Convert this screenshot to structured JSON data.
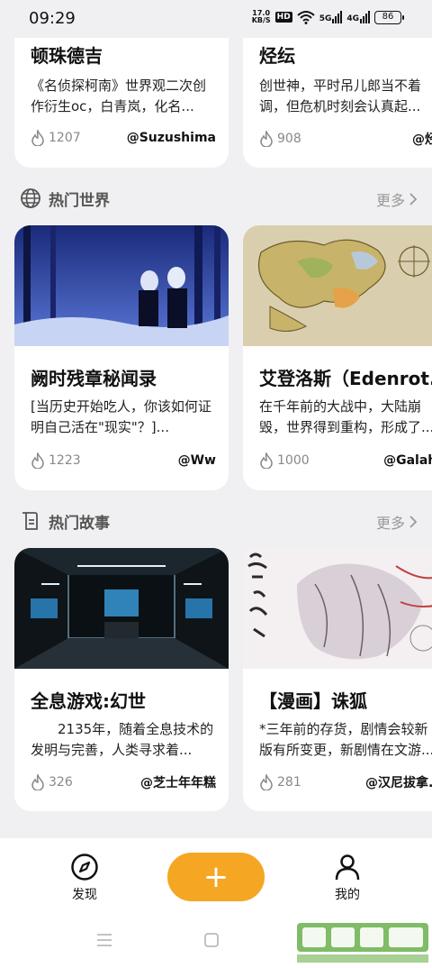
{
  "status": {
    "time": "09:29",
    "net_speed_top": "17.0",
    "net_speed_bottom": "KB/S",
    "hd": "HD",
    "sig1": "5G",
    "sig2": "4G",
    "battery": "86"
  },
  "top_cards": [
    {
      "title": "顿珠德吉",
      "desc": "《名侦探柯南》世界观二次创作衍生oc，白青岚，化名...",
      "heat": "1207",
      "author": "@Suzushima"
    },
    {
      "title": "烃纭",
      "desc": "创世神，平时吊儿郎当不着调，但危机时刻会认真起...",
      "heat": "908",
      "author": "@烃纭"
    }
  ],
  "worlds": {
    "section_title": "热门世界",
    "more_label": "更多",
    "cards": [
      {
        "title": "阙时残章秘闻录",
        "desc": "[当历史开始吃人，你该如何证明自己活在\"现实\"？]...",
        "heat": "1223",
        "author": "@Ww",
        "img_caption": ""
      },
      {
        "title": "艾登洛斯（Edenrot...",
        "desc": "在千年前的大战中，大陆崩毁，世界得到重构，形成了...",
        "heat": "1000",
        "author": "@Galahin",
        "img_caption": ""
      }
    ]
  },
  "stories": {
    "section_title": "热门故事",
    "more_label": "更多",
    "cards": [
      {
        "title": "全息游戏:幻世",
        "desc": "　　2135年，随着全息技术的发明与完善，人类寻求着...",
        "heat": "326",
        "author": "@芝士年年糕"
      },
      {
        "title": "【漫画】诛狐",
        "desc": "*三年前的存货，剧情会较新版有所变更，新剧情在文游...",
        "heat": "281",
        "author": "@汉尼拔拿..."
      }
    ]
  },
  "nav": {
    "discover_label": "发现",
    "me_label": "我的",
    "fab_label": "+"
  },
  "colors": {
    "accent": "#f5a623",
    "background": "#f0f0f2"
  }
}
